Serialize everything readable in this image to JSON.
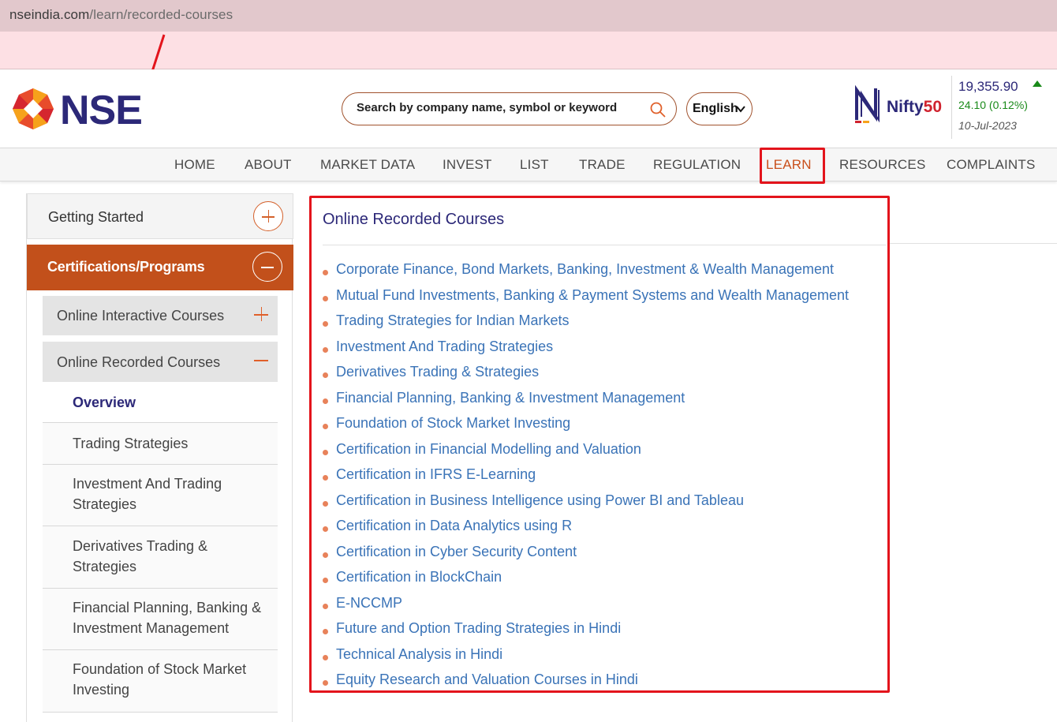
{
  "browser": {
    "url_domain": "nseindia.com",
    "url_path": "/learn/recorded-courses"
  },
  "header": {
    "logo_text": "NSE",
    "search_placeholder": "Search by company name, symbol or keyword",
    "language": "English",
    "nifty_label_prefix": "Nifty",
    "nifty_label_suffix": "50",
    "index_price": "19,355.90",
    "index_change": "24.10 (0.12%)",
    "index_date": "10-Jul-2023",
    "index_direction": "up"
  },
  "nav": {
    "items": [
      "HOME",
      "ABOUT",
      "MARKET DATA",
      "INVEST",
      "LIST",
      "TRADE",
      "REGULATION",
      "LEARN",
      "RESOURCES",
      "COMPLAINTS"
    ],
    "active": "LEARN"
  },
  "sidebar": {
    "getting_started": "Getting Started",
    "certifications": "Certifications/Programs",
    "online_interactive": "Online Interactive Courses",
    "online_recorded": "Online Recorded Courses",
    "leaves": [
      "Overview",
      "Trading Strategies",
      "Investment And Trading Strategies",
      "Derivatives Trading & Strategies",
      "Financial Planning, Banking & Investment Management",
      "Foundation of Stock Market Investing"
    ]
  },
  "content": {
    "title": "Online Recorded Courses",
    "links": [
      "Corporate Finance, Bond Markets, Banking, Investment & Wealth Management",
      "Mutual Fund Investments, Banking & Payment Systems and Wealth Management",
      "Trading Strategies for Indian Markets",
      "Investment And Trading Strategies",
      "Derivatives Trading & Strategies",
      "Financial Planning, Banking & Investment Management",
      "Foundation of Stock Market Investing",
      "Certification in Financial Modelling and Valuation",
      "Certification in IFRS E-Learning",
      "Certification in Business Intelligence using Power BI and Tableau",
      "Certification in Data Analytics using R",
      "Certification in Cyber Security Content",
      "Certification in BlockChain",
      "E-NCCMP",
      "Future and Option Trading Strategies in Hindi",
      "Technical Analysis in Hindi",
      "Equity Research and Valuation Courses in Hindi"
    ]
  },
  "colors": {
    "brand_navy": "#2c2878",
    "brand_orange": "#c2501b",
    "link_blue": "#3a73b7",
    "highlight_red": "#e3141c",
    "positive_green": "#1a8a1a"
  }
}
